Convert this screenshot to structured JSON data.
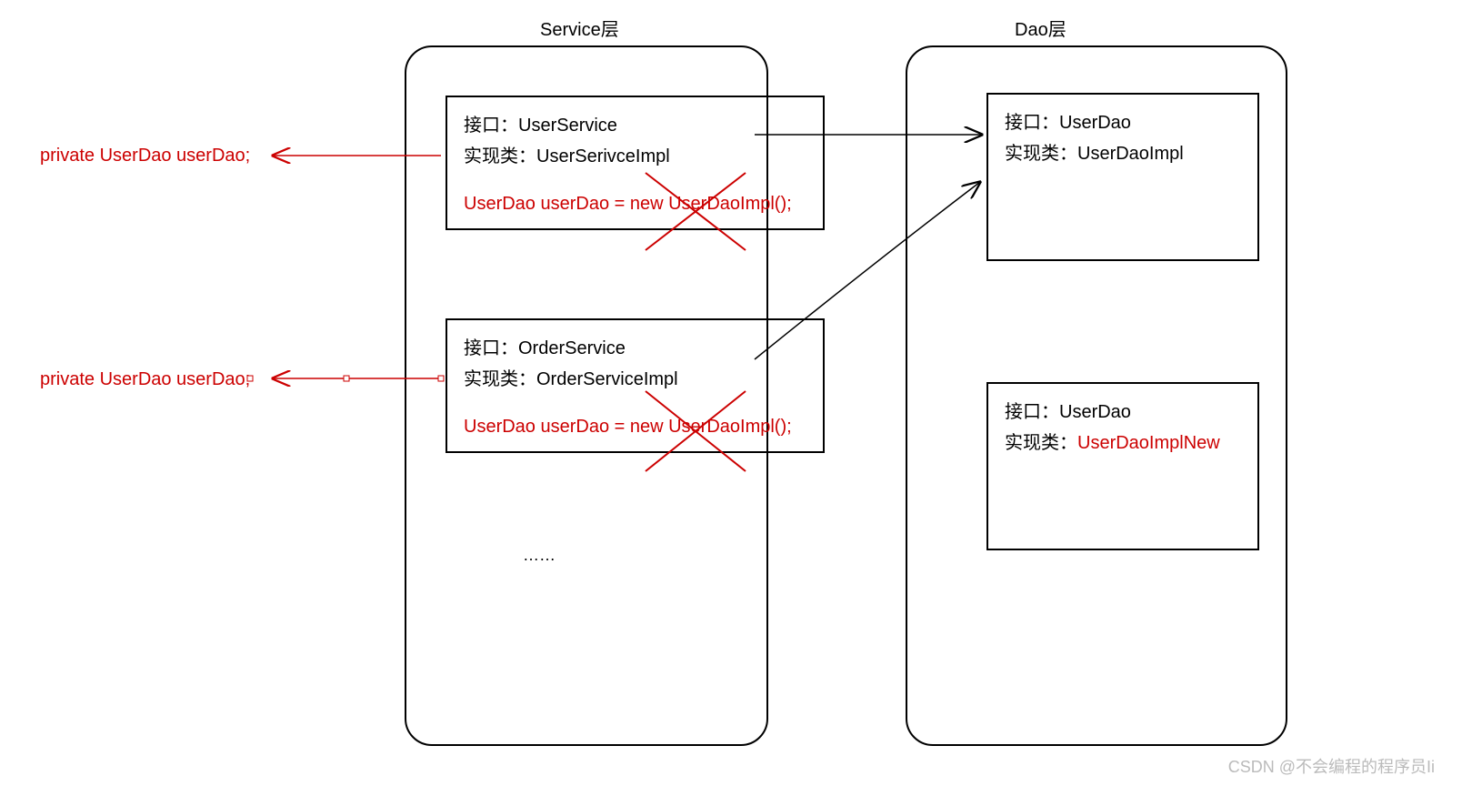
{
  "layers": {
    "service": {
      "title": "Service层"
    },
    "dao": {
      "title": "Dao层"
    }
  },
  "left_annotations": {
    "top": "private UserDao userDao;",
    "bottom": "private UserDao userDao;"
  },
  "service_boxes": {
    "box1": {
      "line1_label": "接口：",
      "line1_value": "UserService",
      "line2_label": "实现类：",
      "line2_value": "UserSerivceImpl",
      "code": "UserDao userDao = new UserDaoImpl();"
    },
    "box2": {
      "line1_label": "接口：",
      "line1_value": "OrderService",
      "line2_label": "实现类：",
      "line2_value": "OrderServiceImpl",
      "code": "UserDao userDao = new UserDaoImpl();"
    },
    "ellipsis": "……"
  },
  "dao_boxes": {
    "box1": {
      "line1_label": "接口：",
      "line1_value": "UserDao",
      "line2_label": "实现类：",
      "line2_value": "UserDaoImpl"
    },
    "box2": {
      "line1_label": "接口：",
      "line1_value": "UserDao",
      "line2_label": "实现类：",
      "line2_value": "UserDaoImplNew"
    }
  },
  "watermark": "CSDN @不会编程的程序员Ii",
  "colors": {
    "red": "#cc0000",
    "black": "#000000"
  }
}
